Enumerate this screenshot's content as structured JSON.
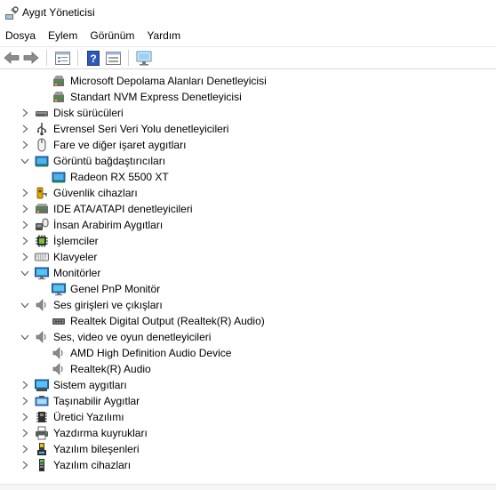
{
  "window": {
    "title": "Aygıt Yöneticisi"
  },
  "menu": [
    "Dosya",
    "Eylem",
    "Görünüm",
    "Yardım"
  ],
  "toolbar": [
    "back-icon",
    "forward-icon",
    "properties-icon",
    "help-icon",
    "action-view-icon",
    "monitor-scan-icon"
  ],
  "tree": [
    {
      "label": "Microsoft Depolama Alanları Denetleyicisi",
      "level": 2,
      "expander": "none",
      "icon": "storage-controller-icon"
    },
    {
      "label": "Standart NVM Express Denetleyicisi",
      "level": 2,
      "expander": "none",
      "icon": "storage-controller-icon"
    },
    {
      "label": "Disk sürücüleri",
      "level": 1,
      "expander": "collapsed",
      "icon": "disk-drive-icon"
    },
    {
      "label": "Evrensel Seri Veri Yolu denetleyicileri",
      "level": 1,
      "expander": "collapsed",
      "icon": "usb-icon"
    },
    {
      "label": "Fare ve diğer işaret aygıtları",
      "level": 1,
      "expander": "collapsed",
      "icon": "mouse-icon"
    },
    {
      "label": "Görüntü bağdaştırıcıları",
      "level": 1,
      "expander": "expanded",
      "icon": "display-adapter-icon"
    },
    {
      "label": "Radeon RX 5500 XT",
      "level": 2,
      "expander": "none",
      "icon": "display-adapter-icon"
    },
    {
      "label": "Güvenlik cihazları",
      "level": 1,
      "expander": "collapsed",
      "icon": "security-key-icon"
    },
    {
      "label": "IDE ATA/ATAPI denetleyicileri",
      "level": 1,
      "expander": "collapsed",
      "icon": "ide-controller-icon"
    },
    {
      "label": "İnsan Arabirim Aygıtları",
      "level": 1,
      "expander": "collapsed",
      "icon": "hid-icon"
    },
    {
      "label": "İşlemciler",
      "level": 1,
      "expander": "collapsed",
      "icon": "processor-icon"
    },
    {
      "label": "Klavyeler",
      "level": 1,
      "expander": "collapsed",
      "icon": "keyboard-icon"
    },
    {
      "label": "Monitörler",
      "level": 1,
      "expander": "expanded",
      "icon": "monitor-icon"
    },
    {
      "label": "Genel PnP Monitör",
      "level": 2,
      "expander": "none",
      "icon": "monitor-icon"
    },
    {
      "label": "Ses girişleri ve çıkışları",
      "level": 1,
      "expander": "expanded",
      "icon": "speaker-icon"
    },
    {
      "label": "Realtek Digital Output (Realtek(R) Audio)",
      "level": 2,
      "expander": "none",
      "icon": "audio-output-icon"
    },
    {
      "label": "Ses, video ve oyun denetleyicileri",
      "level": 1,
      "expander": "expanded",
      "icon": "speaker-icon"
    },
    {
      "label": "AMD High Definition Audio Device",
      "level": 2,
      "expander": "none",
      "icon": "speaker-icon"
    },
    {
      "label": "Realtek(R) Audio",
      "level": 2,
      "expander": "none",
      "icon": "speaker-icon"
    },
    {
      "label": "Sistem aygıtları",
      "level": 1,
      "expander": "collapsed",
      "icon": "system-device-icon"
    },
    {
      "label": "Taşınabilir Aygıtlar",
      "level": 1,
      "expander": "collapsed",
      "icon": "portable-device-icon"
    },
    {
      "label": "Üretici Yazılımı",
      "level": 1,
      "expander": "collapsed",
      "icon": "firmware-icon"
    },
    {
      "label": "Yazdırma kuyrukları",
      "level": 1,
      "expander": "collapsed",
      "icon": "printer-icon"
    },
    {
      "label": "Yazılım bileşenleri",
      "level": 1,
      "expander": "collapsed",
      "icon": "software-component-icon"
    },
    {
      "label": "Yazılım cihazları",
      "level": 1,
      "expander": "collapsed",
      "icon": "software-device-icon"
    }
  ]
}
